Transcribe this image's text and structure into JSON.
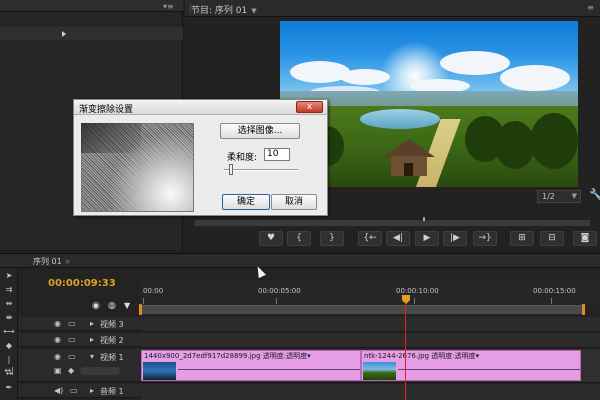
{
  "program_monitor": {
    "tab_label": "节目: 序列 01",
    "zoom_level": "1/2",
    "transport_buttons": [
      "marker",
      "mark-in",
      "mark-out",
      "go-to-in",
      "step-back",
      "play",
      "step-forward",
      "go-to-out",
      "lift",
      "extract",
      "export-frame"
    ]
  },
  "dialog": {
    "title": "渐变擦除设置",
    "close_label": "x",
    "select_image_label": "选择图像...",
    "softness_label": "柔和度:",
    "softness_value": "10",
    "softness_fraction": 0.1,
    "ok_label": "确定",
    "cancel_label": "取消"
  },
  "timeline": {
    "tab_label": "序列 01",
    "tab_close": "×",
    "timecode": "00:00:09:33",
    "ruler_labels": [
      "00:00",
      "00:00:05:00",
      "00:00:10:00",
      "00:00:15:00"
    ],
    "tracks": [
      {
        "name": "视频 3"
      },
      {
        "name": "视频 2"
      },
      {
        "name": "视频 1"
      },
      {
        "name": "音频 1"
      }
    ],
    "clips": [
      {
        "filename": "1440x900_2d7edf917d28899.jpg",
        "effect": "透明度:透明度"
      },
      {
        "filename": "ntk-1244-2676.jpg",
        "effect": "透明度:透明度"
      }
    ]
  },
  "colors": {
    "timecode": "#e0a020",
    "clip": "#e59ee6",
    "playhead": "#e02020",
    "work_area_handle": "#e08a20"
  }
}
